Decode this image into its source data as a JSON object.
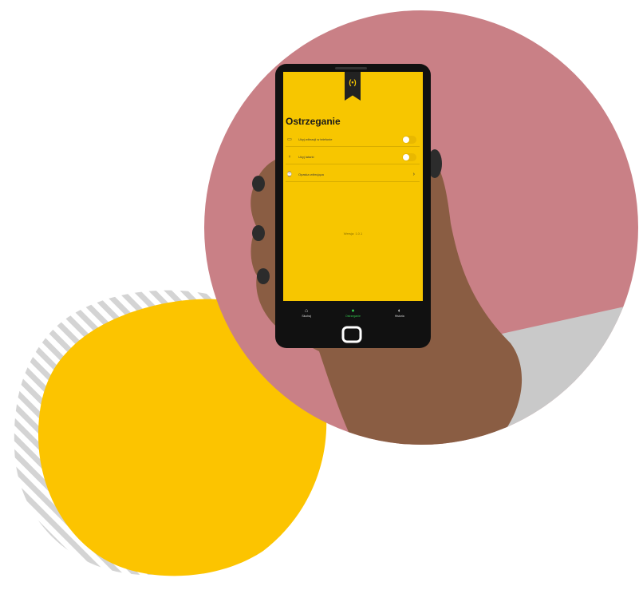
{
  "app": {
    "title": "Ostrzeganie",
    "badge_icon": "(•)",
    "settings": [
      {
        "icon": "vibration-icon",
        "glyph": "▭",
        "label": "Użyj wibracji w telefonie",
        "control": "toggle",
        "on": false
      },
      {
        "icon": "flashlight-icon",
        "glyph": "♀",
        "label": "Użyj latarki",
        "control": "toggle",
        "on": false
      },
      {
        "icon": "watch-icon",
        "glyph": "⌚",
        "label": "Opaska wibrująca",
        "control": "chevron",
        "chevron": "›"
      }
    ],
    "version": "Wersja: 1.0.1",
    "nav": [
      {
        "icon": "home-icon",
        "glyph": "⌂",
        "label": "Słuchaj",
        "active": false
      },
      {
        "icon": "settings-icon",
        "glyph": "●",
        "label": "Ostrzeganie",
        "active": true
      },
      {
        "icon": "history-icon",
        "glyph": "◐",
        "label": "Historia",
        "active": false
      }
    ]
  },
  "colors": {
    "accent_yellow": "#f7c600",
    "background_pink": "#c98086",
    "active_green": "#33c24d",
    "phone_black": "#111111"
  }
}
